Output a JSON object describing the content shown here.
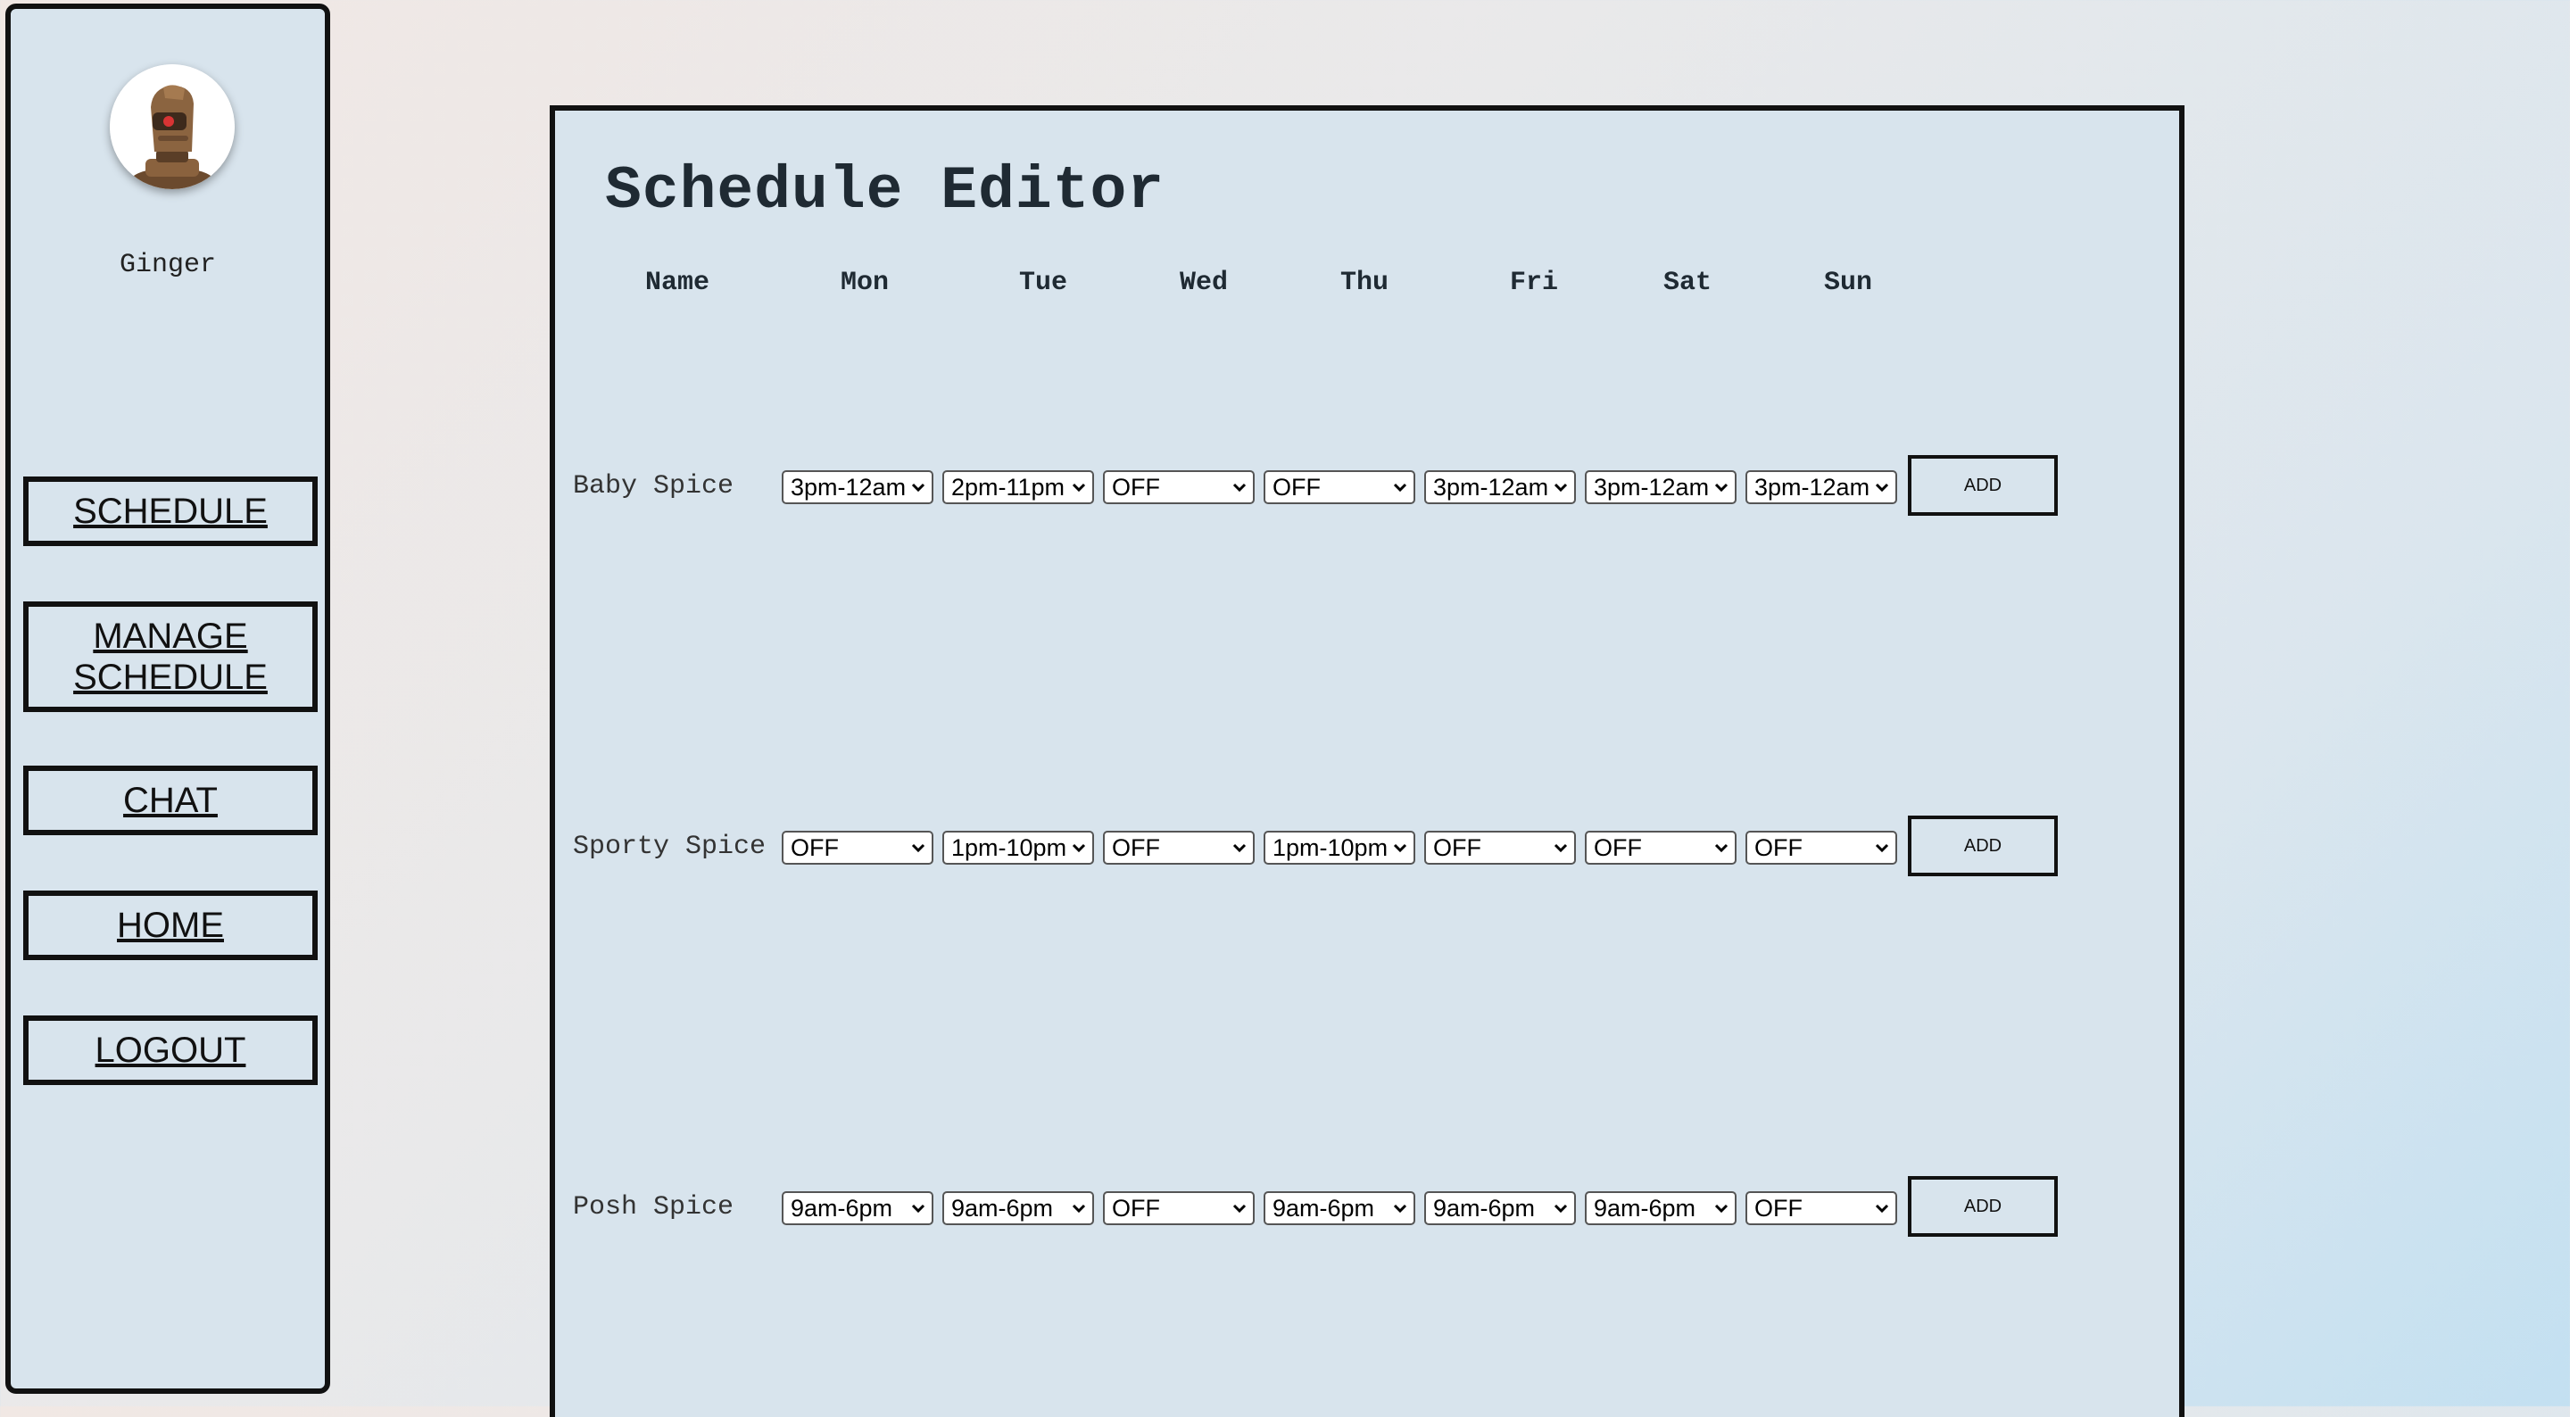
{
  "user": {
    "name": "Ginger"
  },
  "nav": {
    "items": [
      {
        "label": "SCHEDULE"
      },
      {
        "label": "MANAGE SCHEDULE"
      },
      {
        "label": "CHAT"
      },
      {
        "label": "HOME"
      },
      {
        "label": "LOGOUT"
      }
    ]
  },
  "editor": {
    "title": "Schedule Editor",
    "headers": [
      "Name",
      "Mon",
      "Tue",
      "Wed",
      "Thu",
      "Fri",
      "Sat",
      "Sun"
    ],
    "add_label": "ADD",
    "rows": [
      {
        "name": "Baby Spice",
        "shifts": [
          "3pm-12am",
          "2pm-11pm",
          "OFF",
          "OFF",
          "3pm-12am",
          "3pm-12am",
          "3pm-12am"
        ]
      },
      {
        "name": "Sporty Spice",
        "shifts": [
          "OFF",
          "1pm-10pm",
          "OFF",
          "1pm-10pm",
          "OFF",
          "OFF",
          "OFF"
        ]
      },
      {
        "name": "Posh Spice",
        "shifts": [
          "9am-6pm",
          "9am-6pm",
          "OFF",
          "9am-6pm",
          "9am-6pm",
          "9am-6pm",
          "OFF"
        ]
      }
    ]
  }
}
